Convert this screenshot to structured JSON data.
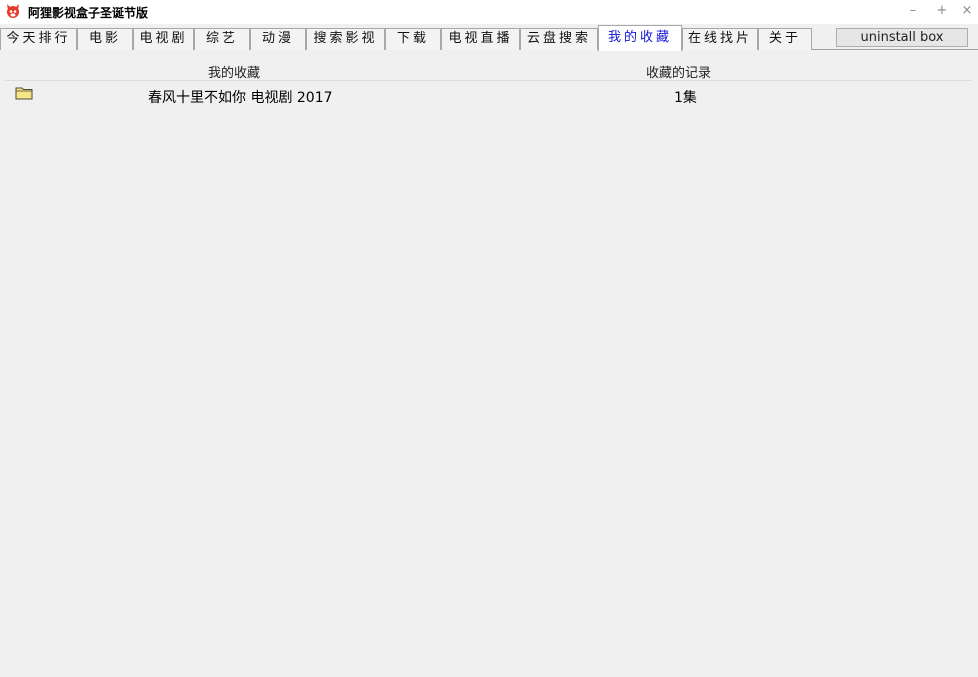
{
  "window": {
    "title": "阿狸影视盒子圣诞节版",
    "controls": {
      "minimize": "–",
      "maximize": "+",
      "close": "×"
    }
  },
  "tabs": [
    {
      "label": "今天排行",
      "active": false
    },
    {
      "label": "电影",
      "active": false
    },
    {
      "label": "电视剧",
      "active": false
    },
    {
      "label": "综艺",
      "active": false
    },
    {
      "label": "动漫",
      "active": false
    },
    {
      "label": "搜索影视",
      "active": false
    },
    {
      "label": "下载",
      "active": false
    },
    {
      "label": "电视直播",
      "active": false
    },
    {
      "label": "云盘搜索",
      "active": false
    },
    {
      "label": "我的收藏",
      "active": true
    },
    {
      "label": "在线找片",
      "active": false
    },
    {
      "label": "关于",
      "active": false
    }
  ],
  "toolbar": {
    "uninstall_label": "uninstall box"
  },
  "list": {
    "columns": [
      "我的收藏",
      "收藏的记录"
    ],
    "rows": [
      {
        "icon": "folder-icon",
        "name": "春风十里不如你 电视剧 2017",
        "record": "1集"
      }
    ]
  },
  "colors": {
    "active_tab_text": "#1515d8",
    "background": "#f0f0f0",
    "folder_fill": "#f7e58a"
  }
}
